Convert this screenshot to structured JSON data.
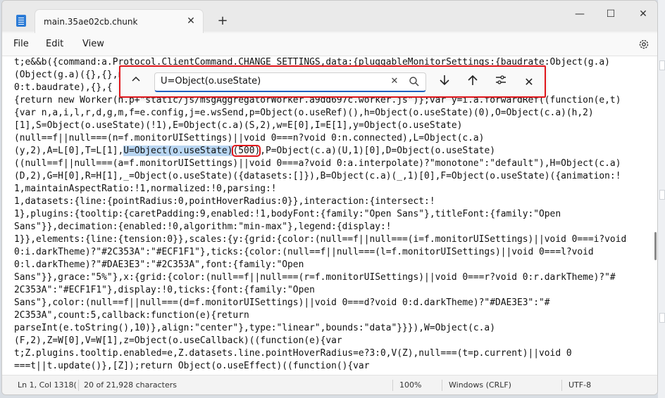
{
  "window": {
    "tab_title": "main.35ae02cb.chunk",
    "tab_close": "✕",
    "new_tab": "+",
    "minimize": "—",
    "maximize": "☐",
    "close": "✕"
  },
  "menu": {
    "file": "File",
    "edit": "Edit",
    "view": "View"
  },
  "find": {
    "query": "U=Object(o.useState)",
    "collapse": "^",
    "clear": "✕",
    "next": "↓",
    "prev": "↑",
    "options": "⚙",
    "close": "✕"
  },
  "code_lines": [
    "t;e&&b({command:a.Protocol.ClientCommand.CHANGE_SETTINGS,data:{pluggableMonitorSettings:{baudrate:Object(g.a)",
    "(Object(g.a)({},{},nu",
    "0:t.baudrate),{},{",
    "{return new Worker(n.p+\"static/js/msgAggregatorWorker.a9dd697c.worker.js\")};var y=i.a.forwardRef((function(e,t)",
    "{var n,a,i,l,r,d,g,m,f=e.config,j=e.wsSend,p=Object(o.useRef)(),h=Object(o.useState)(0),O=Object(c.a)(h,2)",
    "[1],S=Object(o.useState)(!1),E=Object(c.a)(S,2),w=E[0],I=E[1],y=Object(o.useState)",
    "(null==f||null===(n=f.monitorUISettings)||void 0===n?void 0:n.connected),L=Object(c.a)",
    {
      "pre": "(y,2),A=L[0],T=L[1],",
      "hl": "U=Object(o.useState)",
      "box": "(500)",
      "post": ",P=Object(c.a)(U,1)[0],D=Object(o.useState)"
    },
    "((null==f||null===(a=f.monitorUISettings)||void 0===a?void 0:a.interpolate)?\"monotone\":\"default\"),H=Object(c.a)",
    "(D,2),G=H[0],R=H[1],_=Object(o.useState)({datasets:[]}),B=Object(c.a)(_,1)[0],F=Object(o.useState)({animation:!",
    "1,maintainAspectRatio:!1,normalized:!0,parsing:!",
    "1,datasets:{line:{pointRadius:0,pointHoverRadius:0}},interaction:{intersect:!",
    "1},plugins:{tooltip:{caretPadding:9,enabled:!1,bodyFont:{family:\"Open Sans\"},titleFont:{family:\"Open",
    "Sans\"}},decimation:{enabled:!0,algorithm:\"min-max\"},legend:{display:!",
    "1}},elements:{line:{tension:0}},scales:{y:{grid:{color:(null==f||null===(i=f.monitorUISettings)||void 0===i?void",
    "0:i.darkTheme)?\"#2C353A\":\"#ECF1F1\"},ticks:{color:(null==f||null===(l=f.monitorUISettings)||void 0===l?void",
    "0:l.darkTheme)?\"#DAE3E3\":\"#2C353A\",font:{family:\"Open",
    "Sans\"}},grace:\"5%\"},x:{grid:{color:(null==f||null===(r=f.monitorUISettings)||void 0===r?void 0:r.darkTheme)?\"#",
    "2C353A\":\"#ECF1F1\"},display:!0,ticks:{font:{family:\"Open",
    "Sans\"},color:(null==f||null===(d=f.monitorUISettings)||void 0===d?void 0:d.darkTheme)?\"#DAE3E3\":\"#",
    "2C353A\",count:5,callback:function(e){return",
    "parseInt(e.toString(),10)},align:\"center\"},type:\"linear\",bounds:\"data\"}}}),W=Object(c.a)",
    "(F,2),Z=W[0],V=W[1],z=Object(o.useCallback)((function(e){var",
    "t;Z.plugins.tooltip.enabled=e,Z.datasets.line.pointHoverRadius=e?3:0,V(Z),null===(t=p.current)||void 0",
    "===t||t.update()},[Z]);return Object(o.useEffect)((function(){var"
  ],
  "status": {
    "position": "Ln 1, Col 1318(",
    "chars": "20 of 21,928 characters",
    "zoom": "100%",
    "eol": "Windows (CRLF)",
    "encoding": "UTF-8"
  },
  "colors": {
    "highlight": "#b9d6f2",
    "annotation": "#e0161b",
    "accent": "#1f5fbf"
  },
  "icons": [
    "notepad-icon",
    "settings-gear-icon",
    "search-icon",
    "arrow-down-icon",
    "arrow-up-icon",
    "options-icon",
    "close-icon"
  ]
}
